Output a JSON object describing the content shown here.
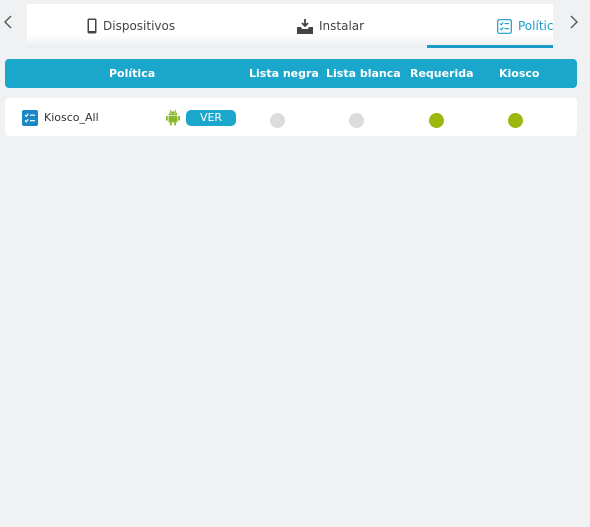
{
  "tabs": {
    "devices_label": "Dispositivos",
    "install_label": "Instalar",
    "policies_label": "Política",
    "active": "policies"
  },
  "icons": {
    "prev": "chevron-left-icon",
    "next": "chevron-right-icon",
    "devices": "smartphone-icon",
    "install": "install-tray-icon",
    "policies": "checklist-icon",
    "row_policy": "checklist-icon",
    "platform": "android-icon"
  },
  "table": {
    "columns": [
      "Política",
      "Lista negra",
      "Lista blanca",
      "Requerida",
      "Kiosco"
    ],
    "rows": [
      {
        "name": "Kiosco_All",
        "platform": "android",
        "action_label": "VER",
        "blacklist": false,
        "whitelist": false,
        "required": true,
        "kiosk": true
      }
    ]
  },
  "colors": {
    "accent": "#1ba6cc",
    "active_dot": "#9ab810",
    "inactive_dot": "#dcdcdc",
    "android": "#8ab82c",
    "background": "#eff1f3"
  }
}
